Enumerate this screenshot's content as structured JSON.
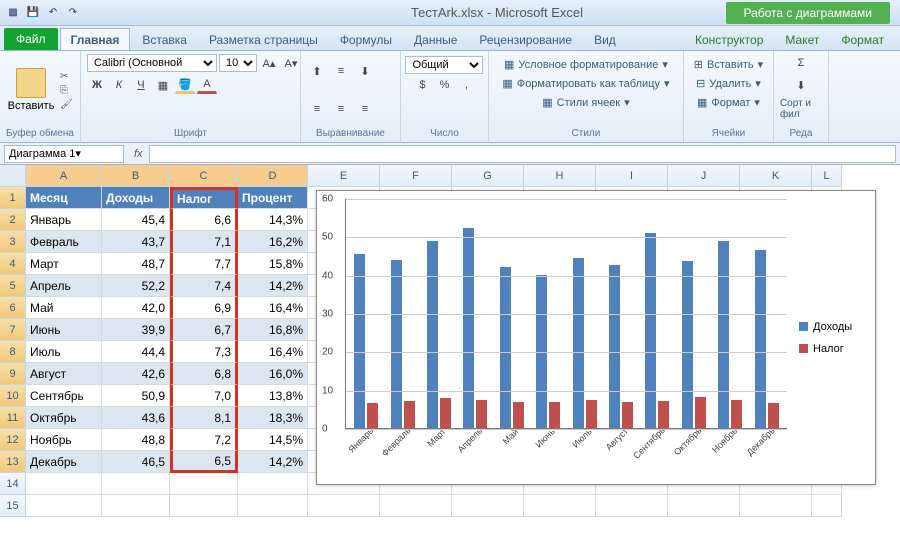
{
  "title": "ТестArk.xlsx - Microsoft Excel",
  "chart_tools": "Работа с диаграммами",
  "tabs": {
    "file": "Файл",
    "home": "Главная",
    "insert": "Вставка",
    "layout": "Разметка страницы",
    "formulas": "Формулы",
    "data": "Данные",
    "review": "Рецензирование",
    "view": "Вид",
    "ctx1": "Конструктор",
    "ctx2": "Макет",
    "ctx3": "Формат"
  },
  "ribbon": {
    "clipboard": {
      "paste": "Вставить",
      "label": "Буфер обмена"
    },
    "font": {
      "name": "Calibri (Основной",
      "size": "10",
      "label": "Шрифт"
    },
    "align": {
      "label": "Выравнивание"
    },
    "number": {
      "fmt": "Общий",
      "label": "Число"
    },
    "styles": {
      "cond": "Условное форматирование",
      "table": "Форматировать как таблицу",
      "cell": "Стили ячеек",
      "label": "Стили"
    },
    "cells": {
      "insert": "Вставить",
      "delete": "Удалить",
      "format": "Формат",
      "label": "Ячейки"
    },
    "edit": {
      "sort": "Сорт и фил",
      "label": "Реда"
    }
  },
  "name_box": "Диаграмма 1",
  "cols": [
    "A",
    "B",
    "C",
    "D",
    "E",
    "F",
    "G",
    "H",
    "I",
    "J",
    "K",
    "L"
  ],
  "headers": {
    "A": "Месяц",
    "B": "Доходы",
    "C": "Налог",
    "D": "Процент"
  },
  "rows": [
    {
      "m": "Январь",
      "d": "45,4",
      "n": "6,6",
      "p": "14,3%"
    },
    {
      "m": "Февраль",
      "d": "43,7",
      "n": "7,1",
      "p": "16,2%"
    },
    {
      "m": "Март",
      "d": "48,7",
      "n": "7,7",
      "p": "15,8%"
    },
    {
      "m": "Апрель",
      "d": "52,2",
      "n": "7,4",
      "p": "14,2%"
    },
    {
      "m": "Май",
      "d": "42,0",
      "n": "6,9",
      "p": "16,4%"
    },
    {
      "m": "Июнь",
      "d": "39,9",
      "n": "6,7",
      "p": "16,8%"
    },
    {
      "m": "Июль",
      "d": "44,4",
      "n": "7,3",
      "p": "16,4%"
    },
    {
      "m": "Август",
      "d": "42,6",
      "n": "6,8",
      "p": "16,0%"
    },
    {
      "m": "Сентябрь",
      "d": "50,9",
      "n": "7,0",
      "p": "13,8%"
    },
    {
      "m": "Октябрь",
      "d": "43,6",
      "n": "8,1",
      "p": "18,3%"
    },
    {
      "m": "Ноябрь",
      "d": "48,8",
      "n": "7,2",
      "p": "14,5%"
    },
    {
      "m": "Декабрь",
      "d": "46,5",
      "n": "6,5",
      "p": "14,2%"
    }
  ],
  "chart_data": {
    "type": "bar",
    "categories": [
      "Январь",
      "Февраль",
      "Март",
      "Апрель",
      "Май",
      "Июнь",
      "Июль",
      "Август",
      "Сентябрь",
      "Октябрь",
      "Ноябрь",
      "Декабрь"
    ],
    "series": [
      {
        "name": "Доходы",
        "values": [
          45.4,
          43.7,
          48.7,
          52.2,
          42.0,
          39.9,
          44.4,
          42.6,
          50.9,
          43.6,
          48.8,
          46.5
        ],
        "color": "#4f81bd"
      },
      {
        "name": "Налог",
        "values": [
          6.6,
          7.1,
          7.7,
          7.4,
          6.9,
          6.7,
          7.3,
          6.8,
          7.0,
          8.1,
          7.2,
          6.5
        ],
        "color": "#c0504d"
      }
    ],
    "ylim": [
      0,
      60
    ],
    "yticks": [
      0,
      10,
      20,
      30,
      40,
      50,
      60
    ],
    "xlabel": "",
    "ylabel": "",
    "title": ""
  },
  "legend": {
    "s1": "Доходы",
    "s2": "Налог"
  }
}
